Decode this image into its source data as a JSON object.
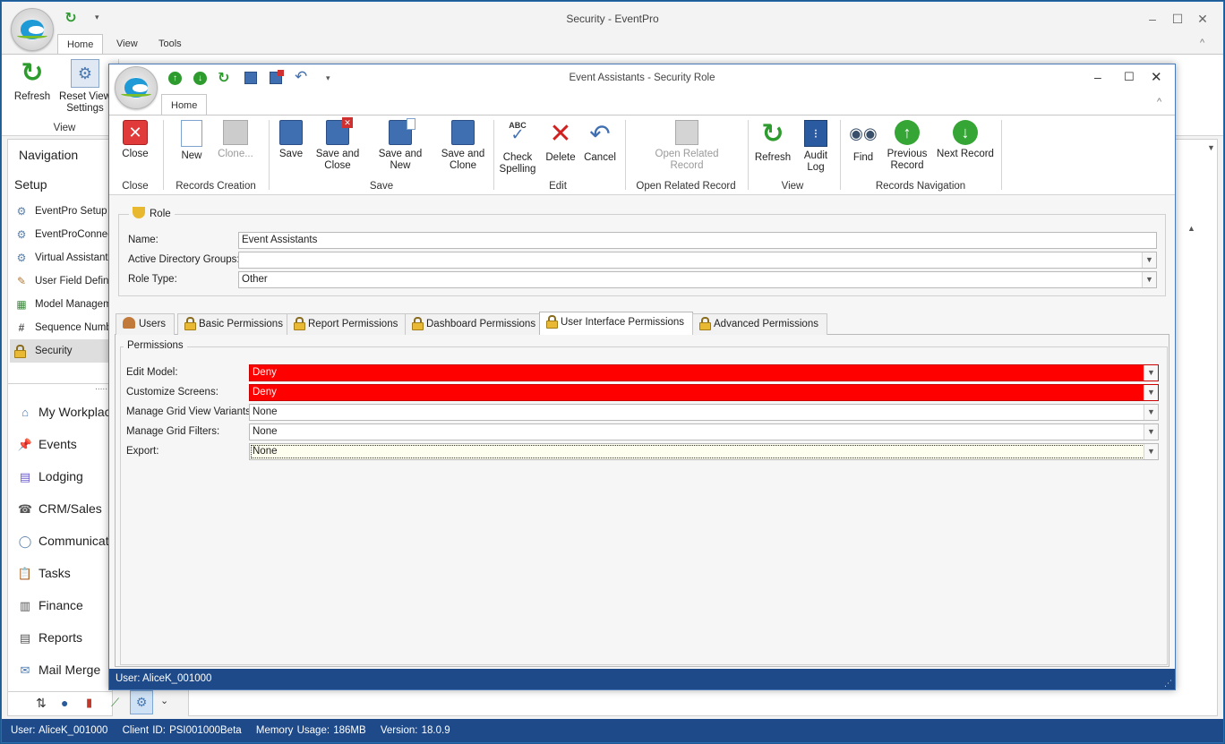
{
  "app": {
    "title": "Security - EventPro",
    "tabs": [
      "Home",
      "View",
      "Tools"
    ],
    "ribbon": {
      "refresh": "Refresh",
      "reset_view_settings": "Reset View\nSettings",
      "group_view": "View"
    },
    "navigation": {
      "header": "Navigation",
      "section": "Setup",
      "items": [
        "EventPro Setup",
        "EventProConnect",
        "Virtual Assistant S",
        "User Field Definiti",
        "Model Manageme",
        "Sequence Numbe",
        "Security"
      ],
      "modules": [
        "My Workplac",
        "Events",
        "Lodging",
        "CRM/Sales",
        "Communicati",
        "Tasks",
        "Finance",
        "Reports",
        "Mail Merge"
      ],
      "grip": "....."
    },
    "status": {
      "user": "User: AliceK_001000",
      "client": "Client ID: PSI001000Beta",
      "memory": "Memory Usage: 186MB",
      "version": "Version: 18.0.9"
    }
  },
  "dialog": {
    "title": "Event Assistants - Security Role",
    "tab": "Home",
    "ribbon": {
      "close": "Close",
      "new": "New",
      "clone": "Clone...",
      "save": "Save",
      "save_and_close": "Save and\nClose",
      "save_and_new": "Save and New",
      "save_and_clone": "Save and\nClone",
      "check_spelling": "Check\nSpelling",
      "delete": "Delete",
      "cancel": "Cancel",
      "open_related_record": "Open Related\nRecord",
      "refresh": "Refresh",
      "audit_log": "Audit\nLog",
      "find": "Find",
      "previous_record": "Previous\nRecord",
      "next_record": "Next Record",
      "groups": {
        "close": "Close",
        "records_creation": "Records Creation",
        "save": "Save",
        "edit": "Edit",
        "open_related_record": "Open Related Record",
        "view": "View",
        "records_navigation": "Records Navigation"
      }
    },
    "role": {
      "legend": "Role",
      "name_label": "Name:",
      "name_value": "Event Assistants",
      "ad_groups_label": "Active Directory Groups:",
      "ad_groups_value": "",
      "role_type_label": "Role Type:",
      "role_type_value": "Other"
    },
    "tabs": [
      "Users",
      "Basic Permissions",
      "Report Permissions",
      "Dashboard Permissions",
      "User Interface Permissions",
      "Advanced Permissions"
    ],
    "active_tab": "User Interface Permissions",
    "permissions": {
      "legend": "Permissions",
      "rows": [
        {
          "label": "Edit Model:",
          "value": "Deny"
        },
        {
          "label": "Customize Screens:",
          "value": "Deny"
        },
        {
          "label": "Manage Grid View Variants:",
          "value": "None"
        },
        {
          "label": "Manage Grid Filters:",
          "value": "None"
        },
        {
          "label": "Export:",
          "value": "None"
        }
      ]
    },
    "status_user": "User: AliceK_001000"
  },
  "colors": {
    "accent": "#1e4a8a",
    "deny": "#ff0000"
  }
}
